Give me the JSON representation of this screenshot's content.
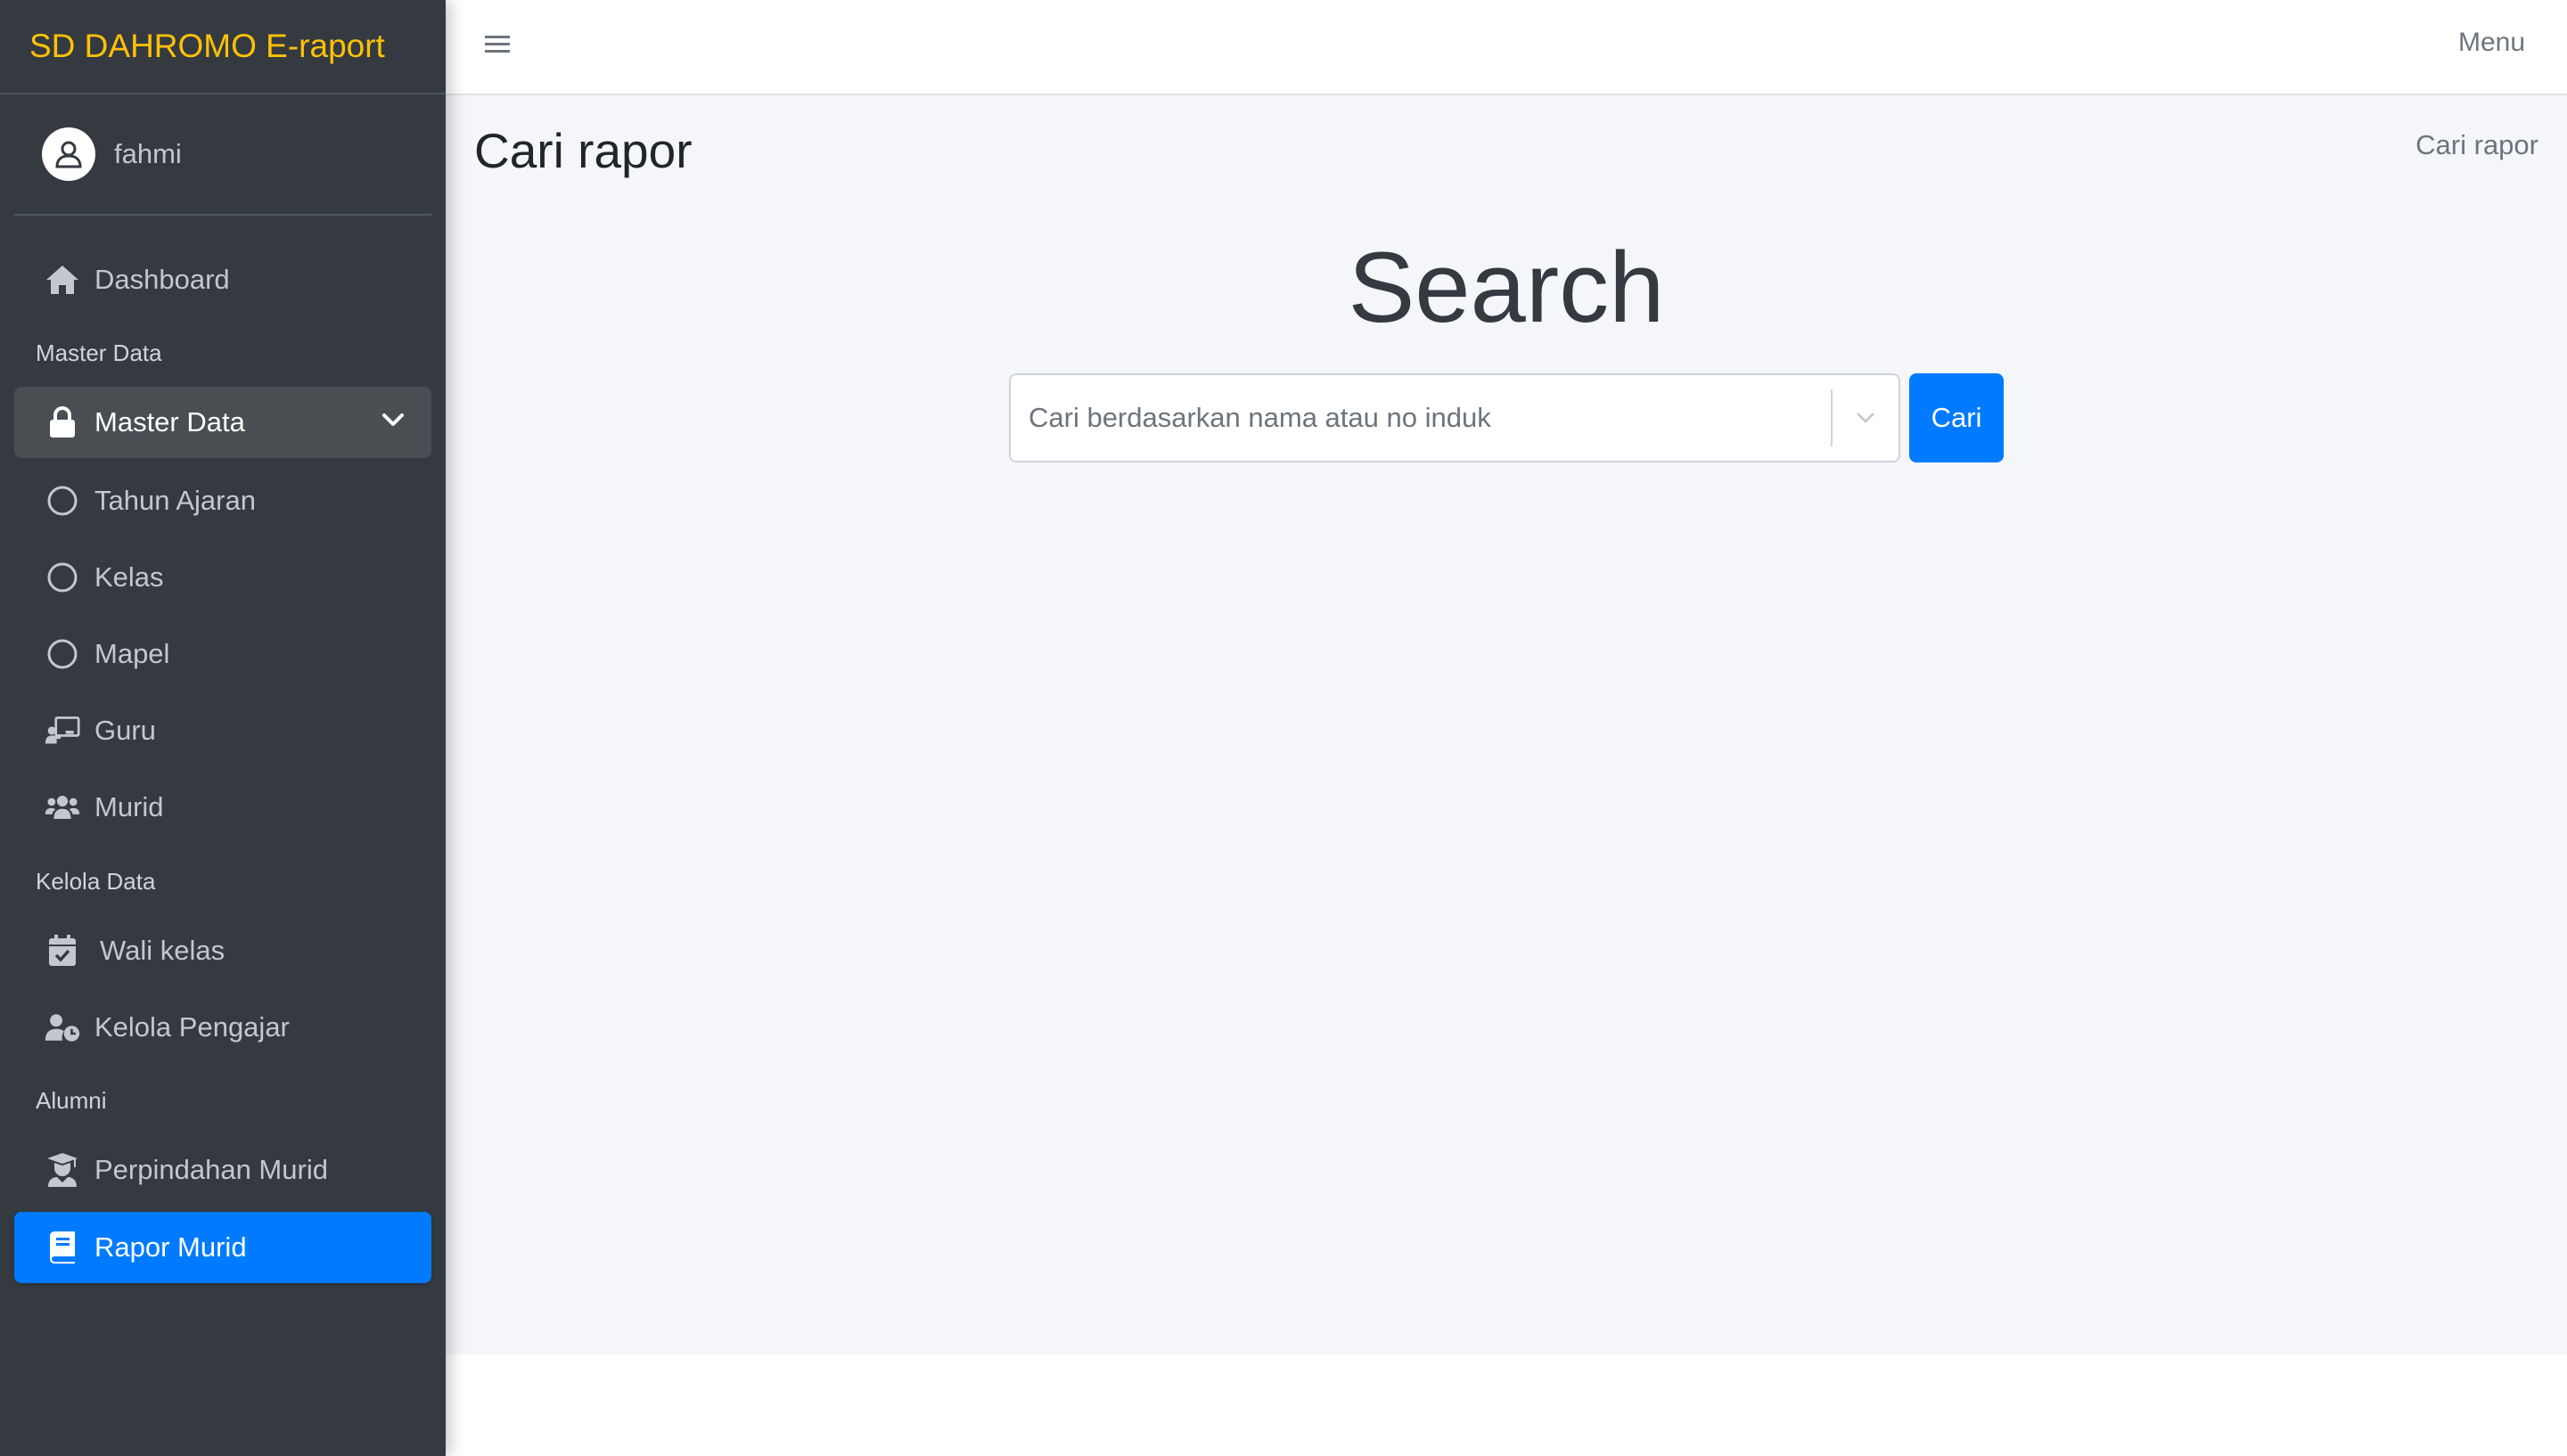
{
  "brand": "SD DAHROMO E-raport",
  "user": {
    "name": "fahmi"
  },
  "topbar": {
    "menu_label": "Menu"
  },
  "sidebar": {
    "dashboard": "Dashboard",
    "header_master": "Master Data",
    "master_data": "Master Data",
    "tahun_ajaran": "Tahun Ajaran",
    "kelas": "Kelas",
    "mapel": "Mapel",
    "guru": "Guru",
    "murid": "Murid",
    "header_kelola": "Kelola Data",
    "wali_kelas": "Wali kelas",
    "kelola_pengajar": "Kelola Pengajar",
    "header_alumni": "Alumni",
    "perpindahan_murid": "Perpindahan Murid",
    "rapor_murid": "Rapor Murid"
  },
  "page": {
    "title": "Cari rapor",
    "breadcrumb": "Cari rapor",
    "search_heading": "Search",
    "search_placeholder": "Cari berdasarkan nama atau no induk",
    "search_button": "Cari"
  },
  "colors": {
    "sidebar_bg": "#343a40",
    "brand": "#ffc107",
    "primary": "#007bff",
    "content_bg": "#f4f6f9"
  }
}
